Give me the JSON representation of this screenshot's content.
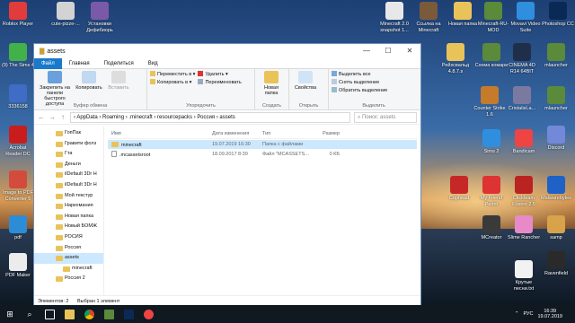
{
  "window": {
    "title": "assets",
    "controls": {
      "minimize": "—",
      "maximize": "☐",
      "close": "✕"
    },
    "tabs": [
      "Файл",
      "Главная",
      "Поделиться",
      "Вид"
    ],
    "ribbon": {
      "clipboard": {
        "pin": "Закрепить на панели быстрого доступа",
        "copy": "Копировать",
        "paste": "Вставить",
        "label": "Буфер обмена"
      },
      "organize": {
        "move": "Переместить в ▾",
        "copy_to": "Копировать в ▾",
        "delete": "Удалить ▾",
        "rename": "Переименовать",
        "label": "Упорядочить"
      },
      "new": {
        "folder": "Новая папка",
        "label": "Создать"
      },
      "open": {
        "properties": "Свойства",
        "label": "Открыть"
      },
      "select": {
        "all": "Выделить все",
        "none": "Снять выделение",
        "invert": "Обратить выделение",
        "label": "Выделить"
      }
    },
    "address": {
      "path": "‹  AppData  ›  Roaming  ›  .minecraft  ›  resourcepacks  ›  Россия  ›  assets",
      "search_placeholder": "Поиск: assets",
      "search_glyph": "⌕"
    },
    "nav_items": [
      "ГопПак",
      "Гравити фолз",
      "Гта",
      "Деньги",
      "ilDefault 3Dr H",
      "ilDefault 3Dr H",
      "Мой текстур",
      "Наркомания",
      "Новая папка",
      "Новый БОМЖ",
      "РОСИЯ",
      "Россия",
      "assets",
      "minecraft",
      "Россия 2"
    ],
    "columns": {
      "name": "Имя",
      "date": "Дата изменения",
      "type": "Тип",
      "size": "Размер"
    },
    "files": [
      {
        "name": "minecraft",
        "date": "19.07.2019 16:30",
        "type": "Папка с файлами",
        "size": ""
      },
      {
        "name": ".mcassetsroot",
        "date": "18.09.2017 8:39",
        "type": "Файл \"MCASSETS...",
        "size": "0 КБ"
      }
    ],
    "status": {
      "count": "Элементов: 2",
      "selected": "Выбран 1 элемент"
    }
  },
  "desktop_icons_left": [
    "Roblox Player",
    "(9) The Sims 4",
    "3336158",
    "Acrobat Reader DC",
    "Image to PDF Converter 5",
    "pdf",
    "PDF Maker"
  ],
  "desktop_icons_top": [
    "cute-pizze-...",
    "Установки Дефибиорь",
    "Minecraft 2.0 snapshot 1...",
    "Ссылка на Minecraft",
    "Новая папка",
    "Minecraft-RU-MOD",
    "Movavi Video Suite",
    "Photoshop CC"
  ],
  "desktop_icons_right": [
    "Рейхсвальд 4.8.7.s",
    "Схема комари",
    "CINEMA 4D R14 64BIT",
    "mlauncher",
    "Counter Strike 1.6",
    "CristalisLa...",
    "mlauncher",
    "Discord",
    "Bandicam",
    "Sims 2",
    "Cuphead",
    "My Friend Pedro",
    "Clickteam Fusion 2.5",
    "Malwarebytes",
    "MCreator",
    "Slime Rancher",
    "samp",
    "Ravenfield",
    "Крутые песни.txt"
  ],
  "clock": {
    "time": "16:39",
    "date": "19.07.2019",
    "lang": "РУС"
  },
  "taskbar": {
    "start": "⊞",
    "search": "⌕"
  },
  "colors": {
    "accent": "#1979ca",
    "selection": "#cce8ff",
    "folder": "#e9c35a"
  }
}
